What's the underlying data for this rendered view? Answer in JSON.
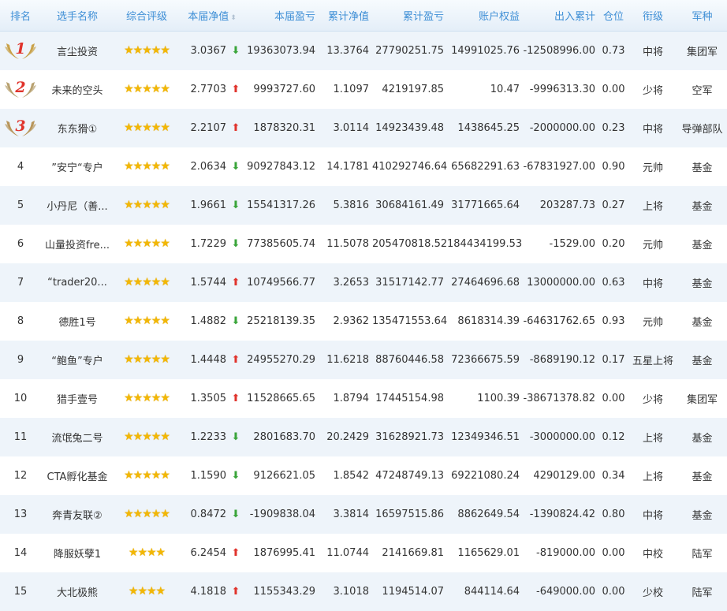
{
  "headers": [
    {
      "key": "rank",
      "label": "排名"
    },
    {
      "key": "name",
      "label": "选手名称"
    },
    {
      "key": "rating",
      "label": "综合评级"
    },
    {
      "key": "nav",
      "label": "本届净值"
    },
    {
      "key": "pnl",
      "label": "本届盈亏"
    },
    {
      "key": "cum_nav",
      "label": "累计净值"
    },
    {
      "key": "cum_pnl",
      "label": "累计盈亏"
    },
    {
      "key": "equity",
      "label": "账户权益"
    },
    {
      "key": "flow",
      "label": "出入累计"
    },
    {
      "key": "position",
      "label": "仓位"
    },
    {
      "key": "military_rank",
      "label": "衔级"
    },
    {
      "key": "branch",
      "label": "军种"
    }
  ],
  "rows": [
    {
      "rank": "1",
      "medal": "gold",
      "name": "言尘投资",
      "stars": "★★★★★",
      "nav": "3.0367",
      "trend": "down",
      "pnl": "19363073.94",
      "cum_nav": "13.3764",
      "cum_pnl": "27790251.75",
      "equity": "14991025.76",
      "flow": "-12508996.00",
      "position": "0.73",
      "military_rank": "中将",
      "branch": "集团军"
    },
    {
      "rank": "2",
      "medal": "silver",
      "name": "未来的空头",
      "stars": "★★★★★",
      "nav": "2.7703",
      "trend": "up",
      "pnl": "9993727.60",
      "cum_nav": "1.1097",
      "cum_pnl": "4219197.85",
      "equity": "10.47",
      "flow": "-9996313.30",
      "position": "0.00",
      "military_rank": "少将",
      "branch": "空军"
    },
    {
      "rank": "3",
      "medal": "bronze",
      "name": "东东猾①",
      "stars": "★★★★★",
      "nav": "2.2107",
      "trend": "up",
      "pnl": "1878320.31",
      "cum_nav": "3.0114",
      "cum_pnl": "14923439.48",
      "equity": "1438645.25",
      "flow": "-2000000.00",
      "position": "0.23",
      "military_rank": "中将",
      "branch": "导弹部队"
    },
    {
      "rank": "4",
      "medal": "",
      "name": "”安宁“专户",
      "stars": "★★★★★",
      "nav": "2.0634",
      "trend": "down",
      "pnl": "90927843.12",
      "cum_nav": "14.1781",
      "cum_pnl": "410292746.64",
      "equity": "65682291.63",
      "flow": "-67831927.00",
      "position": "0.90",
      "military_rank": "元帅",
      "branch": "基金"
    },
    {
      "rank": "5",
      "medal": "",
      "name": "小丹尼（善...",
      "stars": "★★★★★",
      "nav": "1.9661",
      "trend": "down",
      "pnl": "15541317.26",
      "cum_nav": "5.3816",
      "cum_pnl": "30684161.49",
      "equity": "31771665.64",
      "flow": "203287.73",
      "position": "0.27",
      "military_rank": "上将",
      "branch": "基金"
    },
    {
      "rank": "6",
      "medal": "",
      "name": "山量投资fre...",
      "stars": "★★★★★",
      "nav": "1.7229",
      "trend": "down",
      "pnl": "77385605.74",
      "cum_nav": "11.5078",
      "cum_pnl": "205470818.52",
      "equity": "184434199.53",
      "flow": "-1529.00",
      "position": "0.20",
      "military_rank": "元帅",
      "branch": "基金"
    },
    {
      "rank": "7",
      "medal": "",
      "name": "“trader20...",
      "stars": "★★★★★",
      "nav": "1.5744",
      "trend": "up",
      "pnl": "10749566.77",
      "cum_nav": "3.2653",
      "cum_pnl": "31517142.77",
      "equity": "27464696.68",
      "flow": "13000000.00",
      "position": "0.63",
      "military_rank": "中将",
      "branch": "基金"
    },
    {
      "rank": "8",
      "medal": "",
      "name": "德胜1号",
      "stars": "★★★★★",
      "nav": "1.4882",
      "trend": "down",
      "pnl": "25218139.35",
      "cum_nav": "2.9362",
      "cum_pnl": "135471553.64",
      "equity": "8618314.39",
      "flow": "-64631762.65",
      "position": "0.93",
      "military_rank": "元帅",
      "branch": "基金"
    },
    {
      "rank": "9",
      "medal": "",
      "name": "“鲍鱼”专户",
      "stars": "★★★★★",
      "nav": "1.4448",
      "trend": "up",
      "pnl": "24955270.29",
      "cum_nav": "11.6218",
      "cum_pnl": "88760446.58",
      "equity": "72366675.59",
      "flow": "-8689190.12",
      "position": "0.17",
      "military_rank": "五星上将",
      "branch": "基金"
    },
    {
      "rank": "10",
      "medal": "",
      "name": "猎手壹号",
      "stars": "★★★★★",
      "nav": "1.3505",
      "trend": "up",
      "pnl": "11528665.65",
      "cum_nav": "1.8794",
      "cum_pnl": "17445154.98",
      "equity": "1100.39",
      "flow": "-38671378.82",
      "position": "0.00",
      "military_rank": "少将",
      "branch": "集团军"
    },
    {
      "rank": "11",
      "medal": "",
      "name": "流氓兔二号",
      "stars": "★★★★★",
      "nav": "1.2233",
      "trend": "down",
      "pnl": "2801683.70",
      "cum_nav": "20.2429",
      "cum_pnl": "31628921.73",
      "equity": "12349346.51",
      "flow": "-3000000.00",
      "position": "0.12",
      "military_rank": "上将",
      "branch": "基金"
    },
    {
      "rank": "12",
      "medal": "",
      "name": "CTA孵化基金",
      "stars": "★★★★★",
      "nav": "1.1590",
      "trend": "down",
      "pnl": "9126621.05",
      "cum_nav": "1.8542",
      "cum_pnl": "47248749.13",
      "equity": "69221080.24",
      "flow": "4290129.00",
      "position": "0.34",
      "military_rank": "上将",
      "branch": "基金"
    },
    {
      "rank": "13",
      "medal": "",
      "name": "奔青友联②",
      "stars": "★★★★★",
      "nav": "0.8472",
      "trend": "down",
      "pnl": "-1909838.04",
      "cum_nav": "3.3814",
      "cum_pnl": "16597515.86",
      "equity": "8862649.54",
      "flow": "-1390824.42",
      "position": "0.80",
      "military_rank": "中将",
      "branch": "基金"
    },
    {
      "rank": "14",
      "medal": "",
      "name": "降服妖孽1",
      "stars": "★★★★",
      "nav": "6.2454",
      "trend": "up",
      "pnl": "1876995.41",
      "cum_nav": "11.0744",
      "cum_pnl": "2141669.81",
      "equity": "1165629.01",
      "flow": "-819000.00",
      "position": "0.00",
      "military_rank": "中校",
      "branch": "陆军"
    },
    {
      "rank": "15",
      "medal": "",
      "name": "大北极熊",
      "stars": "★★★★",
      "nav": "4.1818",
      "trend": "up",
      "pnl": "1155343.29",
      "cum_nav": "3.1018",
      "cum_pnl": "1194514.07",
      "equity": "844114.64",
      "flow": "-649000.00",
      "position": "0.00",
      "military_rank": "少校",
      "branch": "陆军"
    }
  ],
  "colors": {
    "header_text": "#3f8fd6",
    "stripe": "#eef4fa",
    "star": "#f2b705",
    "up": "#e0332c",
    "down": "#3aa53a",
    "medal_gold": "#c9a24a",
    "medal_silver": "#b8a170",
    "medal_bronze": "#b8955a"
  },
  "icons": {
    "sort": "sort-caret-icon",
    "up": "red-up-arrow-icon",
    "down": "green-down-arrow-icon",
    "medal": "laurel-wings-icon"
  }
}
